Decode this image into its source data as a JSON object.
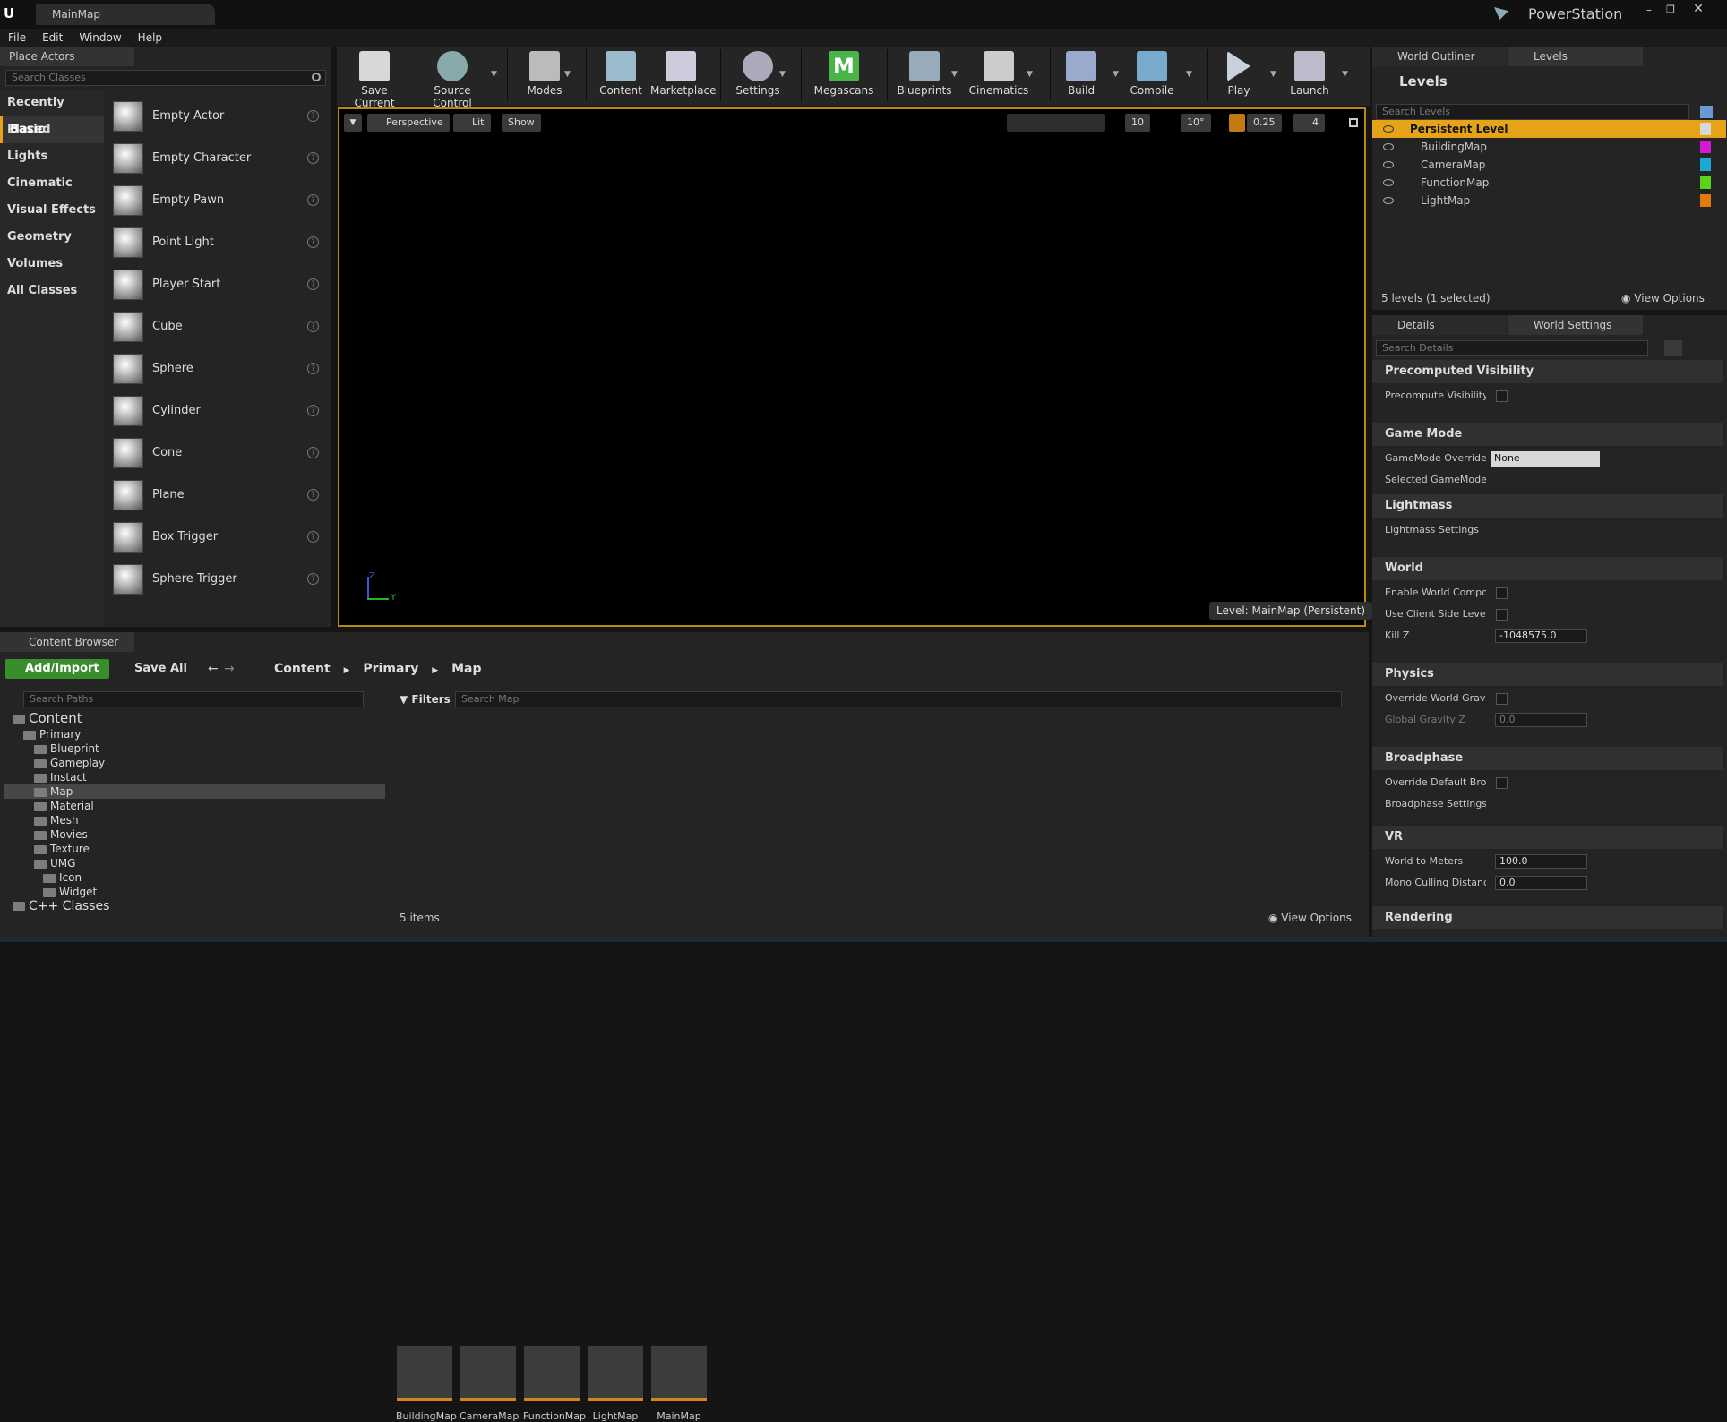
{
  "window": {
    "tab_title": "MainMap",
    "project": "PowerStation"
  },
  "menu": [
    "File",
    "Edit",
    "Window",
    "Help"
  ],
  "place_actors": {
    "tab": "Place Actors",
    "search_placeholder": "Search Classes",
    "categories": [
      "Recently Placed",
      "Basic",
      "Lights",
      "Cinematic",
      "Visual Effects",
      "Geometry",
      "Volumes",
      "All Classes"
    ],
    "selected_category": "Basic",
    "actors": [
      "Empty Actor",
      "Empty Character",
      "Empty Pawn",
      "Point Light",
      "Player Start",
      "Cube",
      "Sphere",
      "Cylinder",
      "Cone",
      "Plane",
      "Box Trigger",
      "Sphere Trigger"
    ]
  },
  "toolbar": {
    "buttons": [
      "Save Current",
      "Source Control",
      "Modes",
      "Content",
      "Marketplace",
      "Settings",
      "Megascans",
      "Blueprints",
      "Cinematics",
      "Build",
      "Compile",
      "Play",
      "Launch"
    ]
  },
  "viewport": {
    "perspective": "Perspective",
    "lit": "Lit",
    "show": "Show",
    "grid_snap": "10",
    "rotation_snap": "10°",
    "scale_snap": "0.25",
    "camera_speed": "4",
    "level_label": "Level:  MainMap (Persistent)",
    "axis_z": "Z",
    "axis_y": "Y"
  },
  "levels": {
    "tabs": [
      "World Outliner",
      "Levels"
    ],
    "title": "Levels",
    "search_placeholder": "Search Levels",
    "items": [
      {
        "name": "Persistent Level",
        "color": "#e6a317"
      },
      {
        "name": "BuildingMap",
        "color": "#d41ad4"
      },
      {
        "name": "CameraMap",
        "color": "#1aa8d4"
      },
      {
        "name": "FunctionMap",
        "color": "#5ad41a"
      },
      {
        "name": "LightMap",
        "color": "#e07b10"
      }
    ],
    "status": "5 levels (1 selected)",
    "view_options": "View Options"
  },
  "details": {
    "tabs": [
      "Details",
      "World Settings"
    ],
    "search_placeholder": "Search Details",
    "sections": {
      "precomputed": "Precomputed Visibility",
      "precompute_visibility": "Precompute Visibility",
      "game_mode": "Game Mode",
      "gamemode_override": "GameMode Override",
      "gamemode_value": "None",
      "selected_gamemode": "Selected GameMode",
      "lightmass": "Lightmass",
      "lightmass_settings": "Lightmass Settings",
      "world": "World",
      "enable_world_composition": "Enable World Compositi",
      "use_client_side": "Use Client Side Level S",
      "kill_z": "Kill Z",
      "kill_z_value": "-1048575.0",
      "physics": "Physics",
      "override_gravity": "Override World Gravity",
      "global_gravity": "Global Gravity Z",
      "global_gravity_value": "0.0",
      "broadphase": "Broadphase",
      "override_broadphase": "Override Default Broad",
      "broadphase_settings": "Broadphase Settings",
      "vr": "VR",
      "world_to_meters": "World to Meters",
      "world_to_meters_value": "100.0",
      "mono_culling": "Mono Culling Distance",
      "mono_culling_value": "0.0",
      "rendering": "Rendering"
    }
  },
  "content_browser": {
    "tab": "Content Browser",
    "add_import": "Add/Import",
    "save_all": "Save All",
    "breadcrumb": [
      "Content",
      "Primary",
      "Map"
    ],
    "search_paths_placeholder": "Search Paths",
    "filters": "Filters",
    "search_placeholder": "Search Map",
    "tree": {
      "root": "Content",
      "primary": "Primary",
      "children": [
        "Blueprint",
        "Gameplay",
        "Instact",
        "Map",
        "Material",
        "Mesh",
        "Movies",
        "Texture"
      ],
      "umg": "UMG",
      "umg_children": [
        "Icon",
        "Widget"
      ],
      "cpp": "C++ Classes"
    },
    "assets": [
      "BuildingMap",
      "CameraMap",
      "FunctionMap",
      "LightMap",
      "MainMap"
    ],
    "count": "5 items",
    "view_options": "View Options"
  }
}
